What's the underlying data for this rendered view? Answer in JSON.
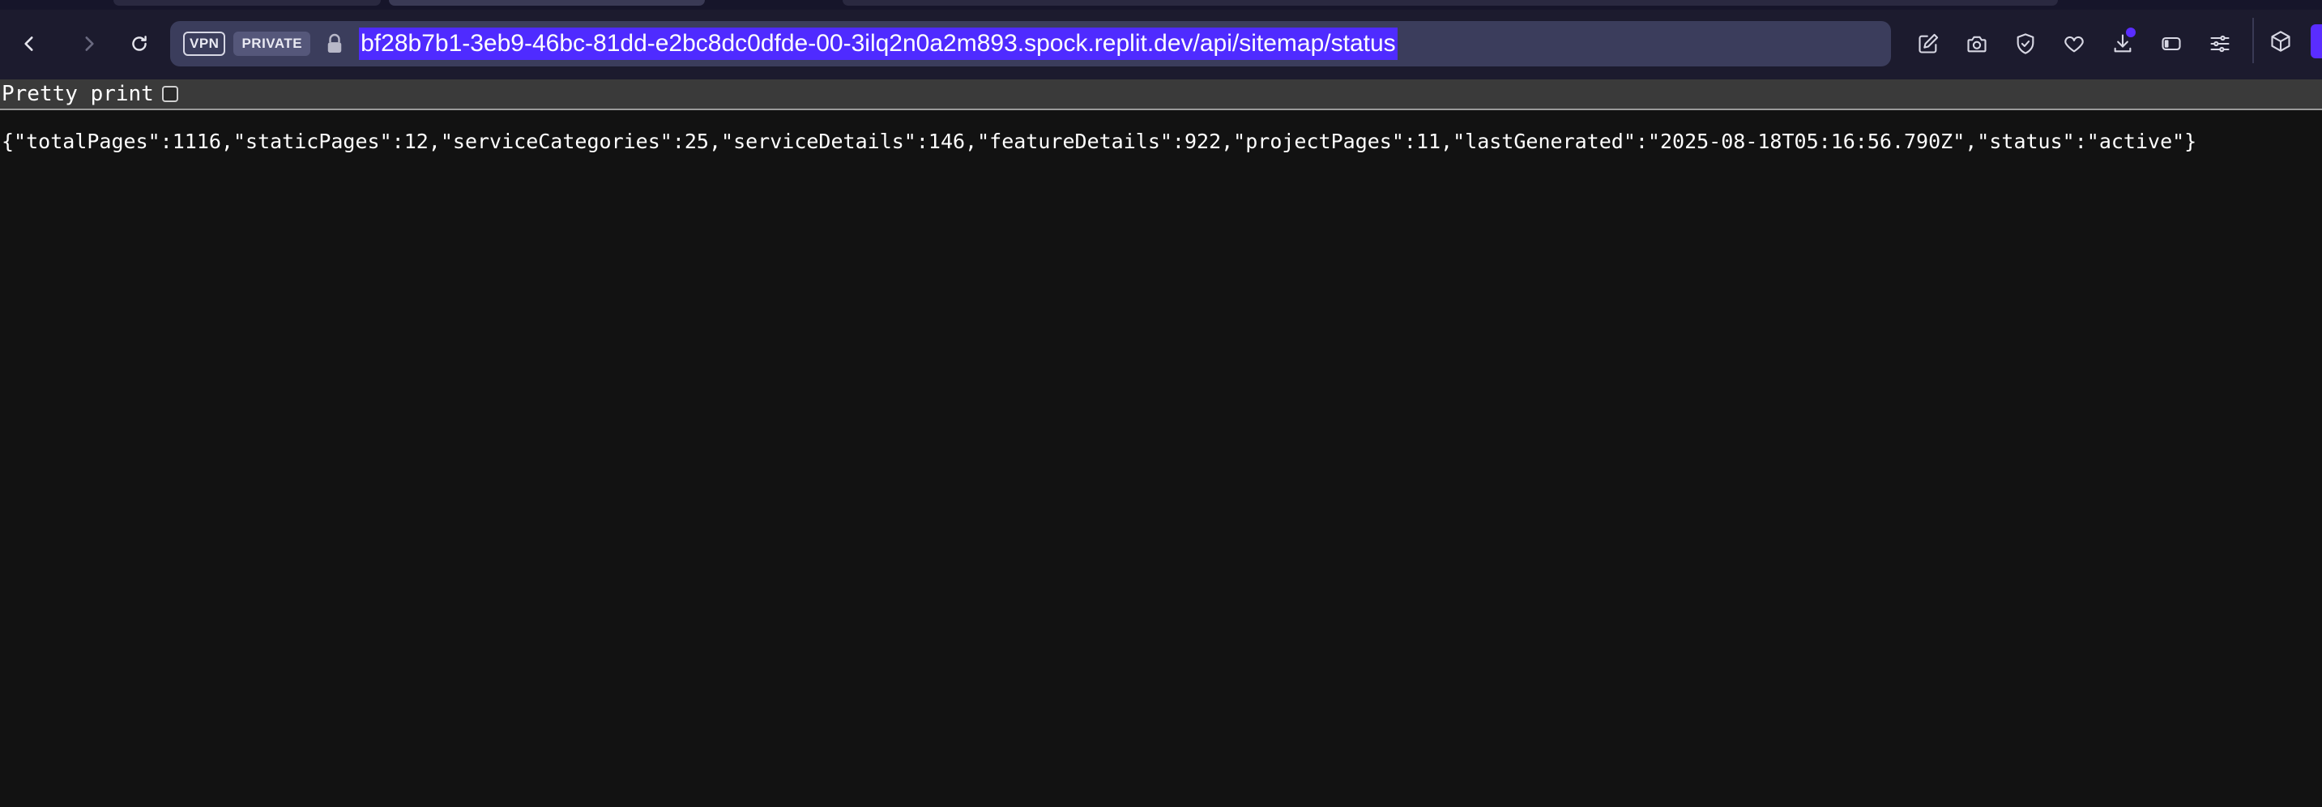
{
  "browser": {
    "badges": {
      "vpn": "VPN",
      "private": "PRIVATE"
    },
    "url": "bf28b7b1-3eb9-46bc-81dd-e2bc8dc0dfde-00-3ilq2n0a2m893.spock.replit.dev/api/sitemap/status",
    "accent_color": "#4f2bff",
    "toolbar_icons": [
      "edit-icon",
      "camera-icon",
      "shield-icon",
      "heart-icon",
      "download-icon",
      "sidebar-icon",
      "menu-icon"
    ]
  },
  "viewer": {
    "pretty_print_label": "Pretty print",
    "pretty_print_checked": false,
    "json_text": "{\"totalPages\":1116,\"staticPages\":12,\"serviceCategories\":25,\"serviceDetails\":146,\"featureDetails\":922,\"projectPages\":11,\"lastGenerated\":\"2025-08-18T05:16:56.790Z\",\"status\":\"active\"}"
  }
}
